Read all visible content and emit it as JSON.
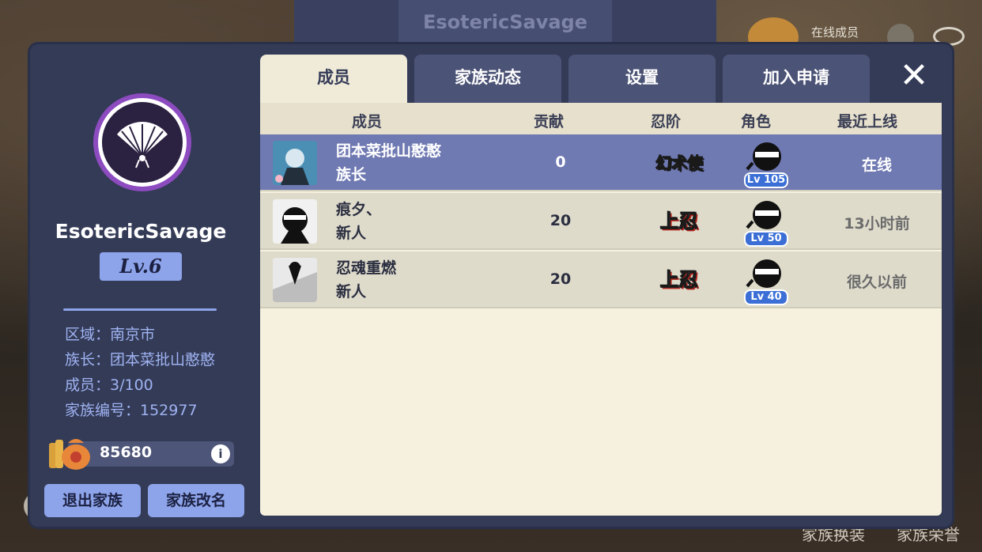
{
  "background": {
    "banner_title": "EsotericSavage",
    "online_members_label": "在线成员",
    "footer_links": [
      "家族换装",
      "家族荣誉"
    ]
  },
  "clan": {
    "name": "EsotericSavage",
    "level": "Lv.6",
    "info": {
      "region": "区域：南京市",
      "leader": "族长：团本菜批山憨憨",
      "members": "成员：3/100",
      "clan_id": "家族编号：152977"
    },
    "currency": "85680",
    "info_button": "i",
    "buttons": {
      "leave": "退出家族",
      "rename": "家族改名"
    }
  },
  "tabs": [
    {
      "label": "成员",
      "active": true
    },
    {
      "label": "家族动态",
      "active": false
    },
    {
      "label": "设置",
      "active": false
    },
    {
      "label": "加入申请",
      "active": false
    }
  ],
  "close_label": "✕",
  "table": {
    "headers": {
      "member": "成员",
      "contribution": "贡献",
      "ninja_rank": "忍阶",
      "role": "角色",
      "last_online": "最近上线"
    },
    "rows": [
      {
        "name": "团本菜批山憨憨",
        "rank": "族长",
        "contribution": "0",
        "ninja_rank": "幻术使",
        "role_level": "Lv 105",
        "last_online": "在线",
        "selected": true
      },
      {
        "name": "痕夕、",
        "rank": "新人",
        "contribution": "20",
        "ninja_rank": "上忍",
        "role_level": "Lv 50",
        "last_online": "13小时前",
        "selected": false
      },
      {
        "name": "忍魂重燃",
        "rank": "新人",
        "contribution": "20",
        "ninja_rank": "上忍",
        "role_level": "Lv 40",
        "last_online": "很久以前",
        "selected": false
      }
    ]
  },
  "colors": {
    "panel": "#343b57",
    "accent": "#8da4ea",
    "selected_row": "#6f79b2",
    "content_bg": "#f6f1de"
  }
}
